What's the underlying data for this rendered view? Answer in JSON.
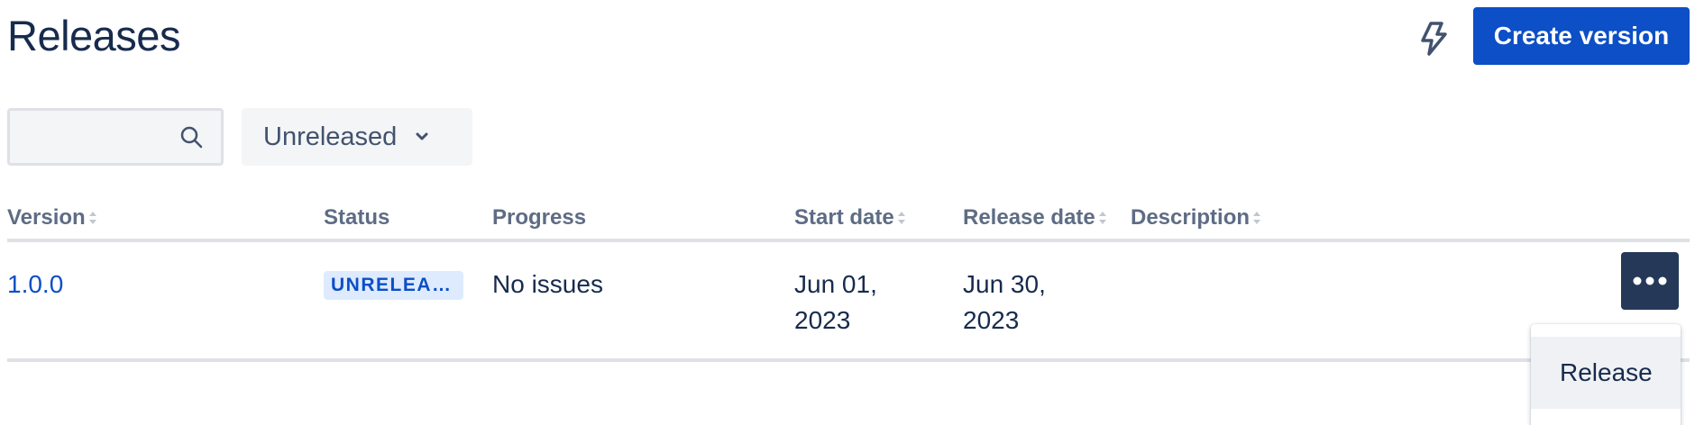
{
  "header": {
    "title": "Releases",
    "create_label": "Create version",
    "automation_icon": "lightning-icon"
  },
  "filters": {
    "search_value": "",
    "search_placeholder": "",
    "status_filter": "Unreleased"
  },
  "table": {
    "columns": [
      "Version",
      "Status",
      "Progress",
      "Start date",
      "Release date",
      "Description"
    ],
    "rows": [
      {
        "version": "1.0.0",
        "status": "UNRELEASED",
        "progress": "No issues",
        "start_date_1": "Jun 01,",
        "start_date_2": "2023",
        "release_date_1": "Jun 30,",
        "release_date_2": "2023",
        "description": ""
      }
    ]
  },
  "menu": {
    "items": [
      "Release"
    ]
  },
  "colors": {
    "primary": "#0c4fc6",
    "dark": "#253858",
    "lozenge_bg": "#deebff"
  }
}
